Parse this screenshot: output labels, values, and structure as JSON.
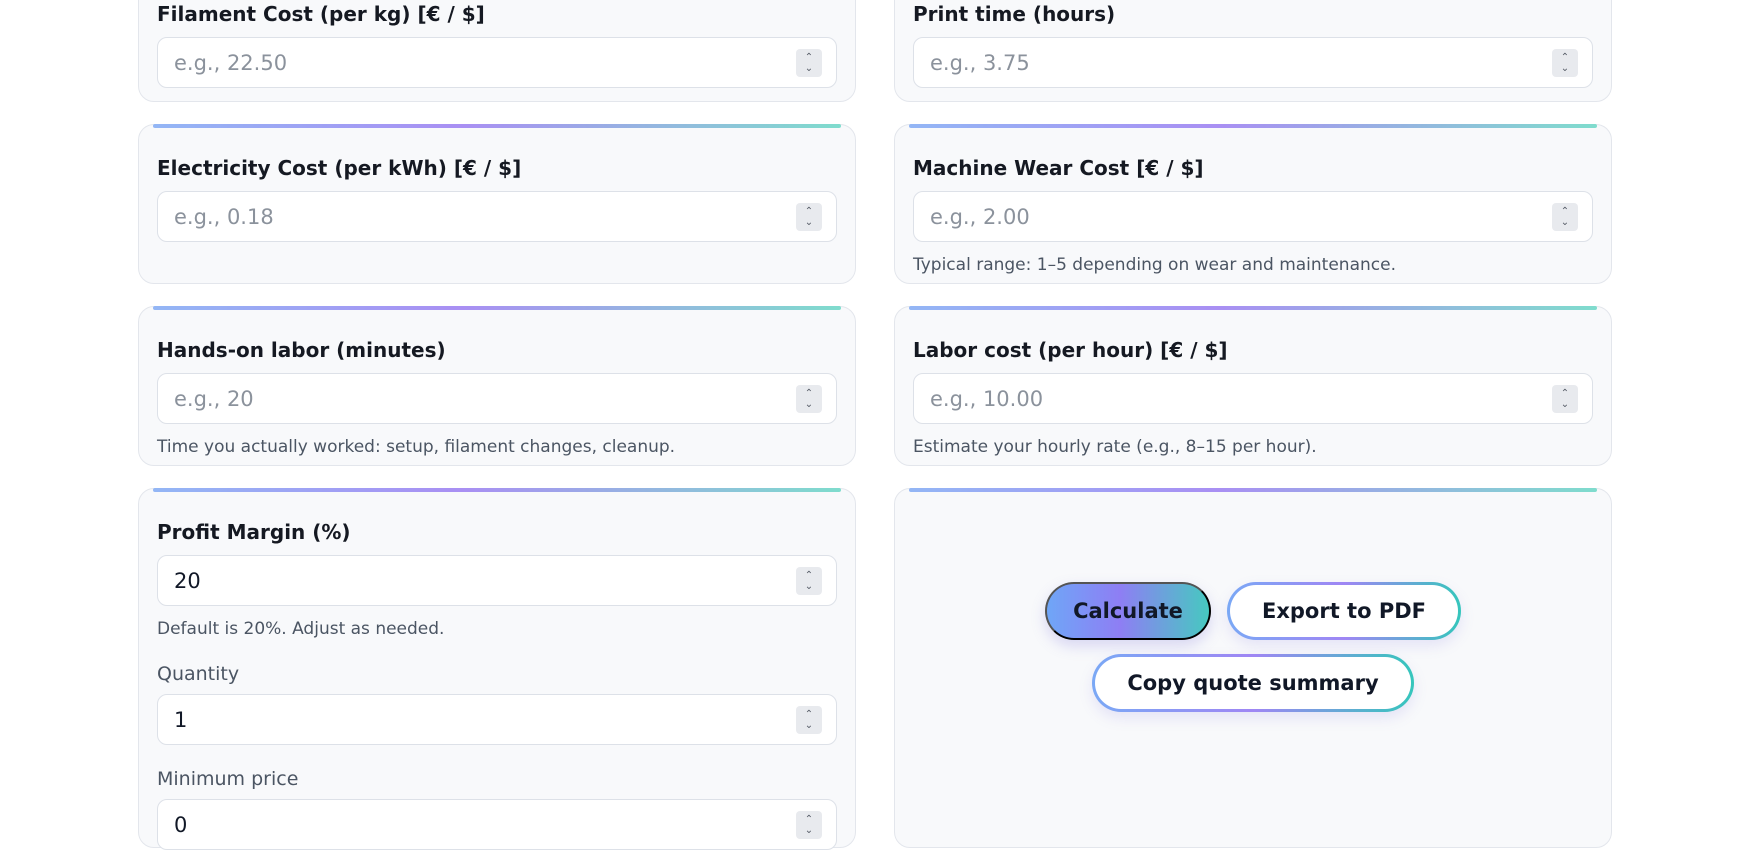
{
  "fields": {
    "filament_cost": {
      "label": "Filament Cost (per kg) [€ / $]",
      "placeholder": "e.g., 22.50"
    },
    "print_time": {
      "label": "Print time (hours)",
      "placeholder": "e.g., 3.75"
    },
    "electricity_cost": {
      "label": "Electricity Cost (per kWh) [€ / $]",
      "placeholder": "e.g., 0.18"
    },
    "machine_wear": {
      "label": "Machine Wear Cost [€ / $]",
      "placeholder": "e.g., 2.00",
      "hint": "Typical range: 1–5 depending on wear and maintenance."
    },
    "labor_minutes": {
      "label": "Hands-on labor (minutes)",
      "placeholder": "e.g., 20",
      "hint": "Time you actually worked: setup, filament changes, cleanup."
    },
    "labor_rate": {
      "label": "Labor cost (per hour) [€ / $]",
      "placeholder": "e.g., 10.00",
      "hint": "Estimate your hourly rate (e.g., 8–15 per hour)."
    },
    "profit_margin": {
      "label": "Profit Margin (%)",
      "value": "20",
      "hint": "Default is 20%. Adjust as needed."
    },
    "quantity": {
      "label": "Quantity",
      "value": "1"
    },
    "minimum_price": {
      "label": "Minimum price",
      "value": "0"
    }
  },
  "actions": {
    "calculate": "Calculate",
    "export_pdf": "Export to PDF",
    "copy_summary": "Copy quote summary"
  },
  "icons": {
    "stepper": "spin-button-icon"
  },
  "colors": {
    "accent_start": "#6fa6f7",
    "accent_mid": "#8e7ef4",
    "accent_end": "#46c9c0"
  }
}
